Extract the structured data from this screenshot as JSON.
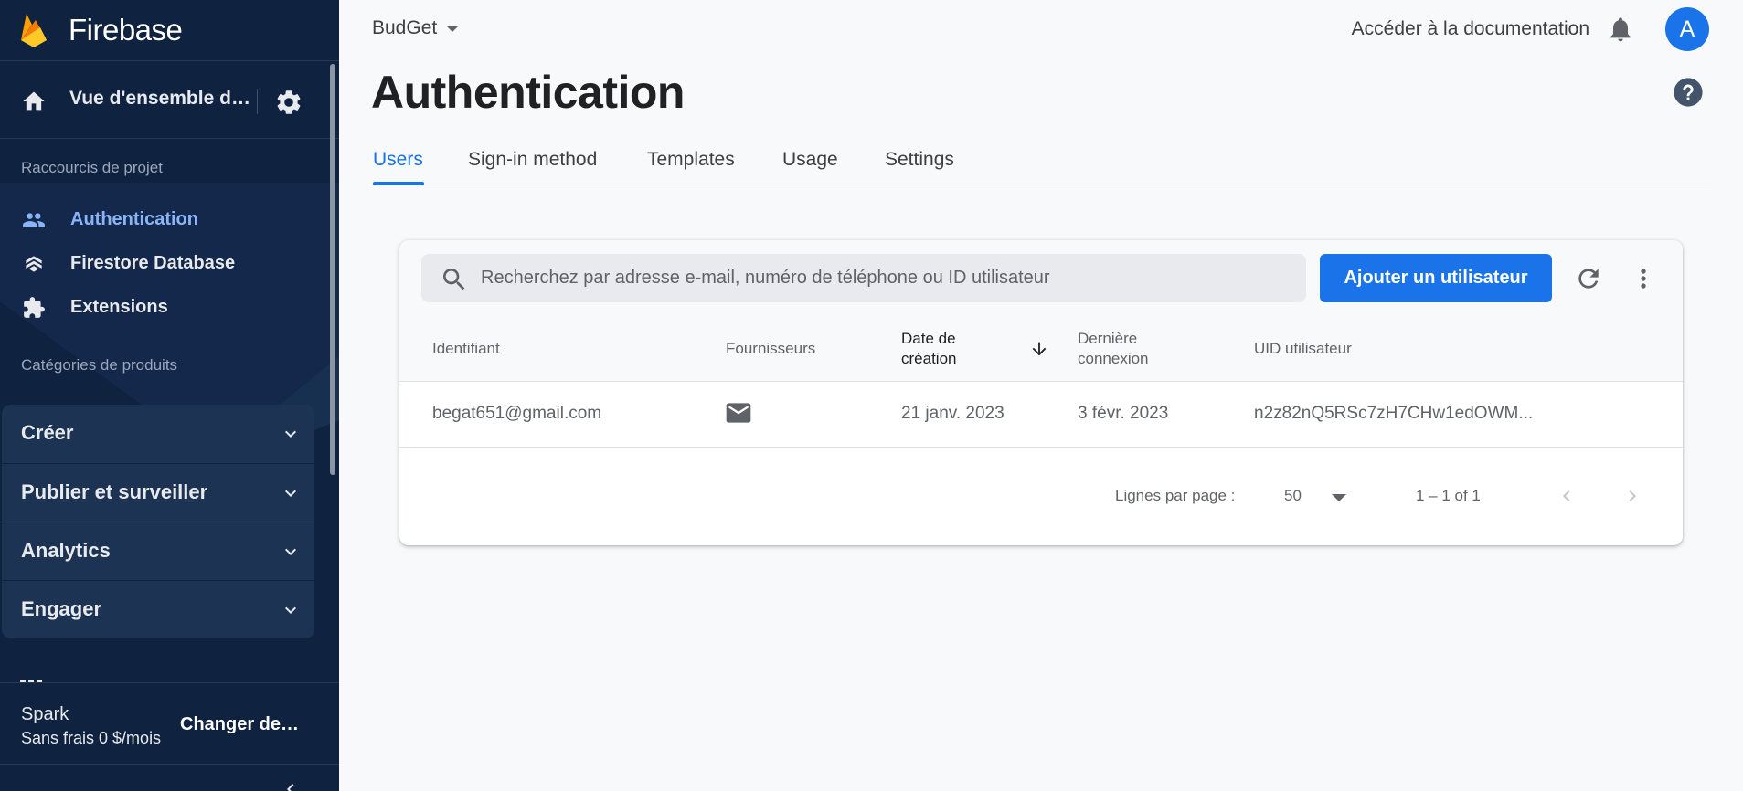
{
  "app": {
    "name": "Firebase"
  },
  "sidebar": {
    "project_overview": "Vue d'ensemble du projet",
    "shortcuts_label": "Raccourcis de projet",
    "shortcuts": [
      {
        "label": "Authentication",
        "icon": "people-icon",
        "active": true
      },
      {
        "label": "Firestore Database",
        "icon": "firestore-icon",
        "active": false
      },
      {
        "label": "Extensions",
        "icon": "extensions-icon",
        "active": false
      }
    ],
    "categories_label": "Catégories de produits",
    "categories": [
      {
        "label": "Créer"
      },
      {
        "label": "Publier et surveiller"
      },
      {
        "label": "Analytics"
      },
      {
        "label": "Engager"
      }
    ],
    "plan": {
      "tier": "Spark",
      "price": "Sans frais 0 $/mois",
      "change_label": "Changer de formule"
    }
  },
  "topbar": {
    "project_name": "BudGet",
    "docs_link": "Accéder à la documentation",
    "avatar_letter": "A"
  },
  "page": {
    "title": "Authentication",
    "tabs": [
      {
        "label": "Users",
        "active": true
      },
      {
        "label": "Sign-in method",
        "active": false
      },
      {
        "label": "Templates",
        "active": false
      },
      {
        "label": "Usage",
        "active": false
      },
      {
        "label": "Settings",
        "active": false
      }
    ]
  },
  "users_table": {
    "search_placeholder": "Recherchez par adresse e-mail, numéro de téléphone ou ID utilisateur",
    "add_user_label": "Ajouter un utilisateur",
    "columns": {
      "identifier": "Identifiant",
      "providers": "Fournisseurs",
      "created_line1": "Date de",
      "created_line2": "création",
      "last_login_line1": "Dernière",
      "last_login_line2": "connexion",
      "uid": "UID utilisateur"
    },
    "rows": [
      {
        "identifier": "begat651@gmail.com",
        "provider_icon": "mail-icon",
        "created": "21 janv. 2023",
        "last_login": "3 févr. 2023",
        "uid": "n2z82nQ5RSc7zH7CHw1edOWM..."
      }
    ],
    "pagination": {
      "rows_per_page_label": "Lignes par page :",
      "rows_per_page": "50",
      "range": "1 – 1 of 1"
    }
  },
  "colors": {
    "sidebar_bg": "#0f2240",
    "accent": "#1a73e8",
    "active_nav": "#8ab4f8"
  }
}
